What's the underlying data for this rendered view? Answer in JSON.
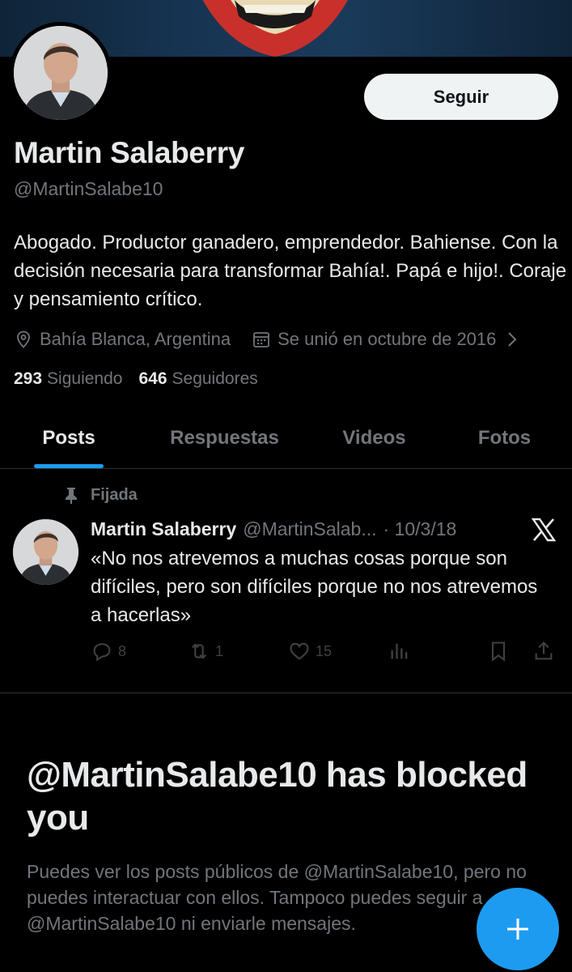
{
  "profile": {
    "name": "Martin Salaberry",
    "handle": "@MartinSalabe10",
    "follow_label": "Seguir",
    "bio": "Abogado. Productor ganadero, emprendedor. Bahiense. Con la decisión necesaria para transformar Bahía!. Papá e hijo!. Coraje y pensamiento crítico.",
    "location": "Bahía Blanca, Argentina",
    "joined": "Se unió en octubre de 2016",
    "following_count": "293",
    "following_label": "Siguiendo",
    "followers_count": "646",
    "followers_label": "Seguidores"
  },
  "tabs": [
    {
      "label": "Posts",
      "active": true
    },
    {
      "label": "Respuestas",
      "active": false
    },
    {
      "label": "Videos",
      "active": false
    },
    {
      "label": "Fotos",
      "active": false
    }
  ],
  "pinned_tweet": {
    "pinned_label": "Fijada",
    "author_name": "Martin Salaberry",
    "author_handle": "@MartinSalab...",
    "date": "· 10/3/18",
    "text": "«No nos atrevemos a muchas cosas porque son difíciles, pero son difíciles porque no nos atrevemos a hacerlas»",
    "replies": "8",
    "reposts": "1",
    "likes": "15"
  },
  "blocked": {
    "title": "@MartinSalabe10 has blocked you",
    "body": "Puedes ver los posts públicos de @MartinSalabe10, pero no puedes interactuar con ellos. Tampoco puedes seguir a @MartinSalabe10 ni enviarle mensajes."
  },
  "colors": {
    "background": "#000000",
    "text": "#e7e9ea",
    "secondary": "#71767b",
    "accent": "#1d9bf0",
    "button_bg": "#eff3f4"
  },
  "icons": [
    "location-icon",
    "calendar-icon",
    "chevron-right-icon",
    "pin-icon",
    "x-logo-icon",
    "reply-icon",
    "repost-icon",
    "like-icon",
    "views-icon",
    "bookmark-icon",
    "share-icon",
    "plus-icon"
  ]
}
